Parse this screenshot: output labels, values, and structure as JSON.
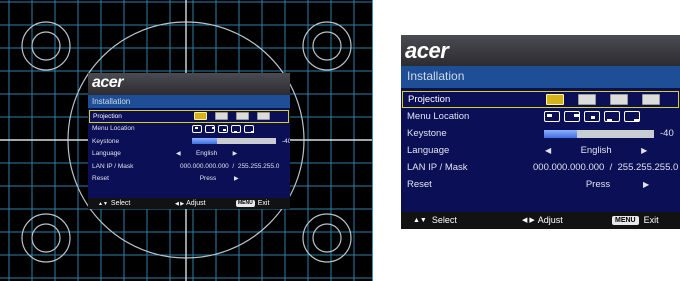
{
  "brand": "acer",
  "menu": {
    "title": "Installation",
    "rows": [
      {
        "label": "Projection",
        "type": "icons",
        "selected": true
      },
      {
        "label": "Menu Location",
        "type": "location"
      },
      {
        "label": "Keystone",
        "type": "slider",
        "value": "-40",
        "level": 0.3
      },
      {
        "label": "Language",
        "type": "choice",
        "value": "English"
      },
      {
        "label": "LAN IP / Mask",
        "type": "text",
        "value": "000.000.000.000  /  255.255.255.0"
      },
      {
        "label": "Reset",
        "type": "action",
        "value": "Press"
      }
    ],
    "footer": {
      "select_glyph": "▲▼",
      "select_label": "Select",
      "adjust_glyph": "◀ ▶",
      "adjust_label": "Adjust",
      "menu_key": "MENU",
      "exit_label": "Exit"
    },
    "projection_icons": [
      "front-desktop-icon",
      "rear-desktop-icon",
      "front-ceiling-icon",
      "rear-ceiling-icon"
    ],
    "location_icons": [
      "top-left-location-icon",
      "top-right-location-icon",
      "center-location-icon",
      "bottom-left-location-icon",
      "bottom-right-location-icon"
    ],
    "arrows": {
      "left": "◀",
      "right": "▶"
    },
    "colors": {
      "title_bar": "#1e4f96",
      "body": "#0b0f55",
      "highlight": "#d9d11b",
      "footer": "#121212",
      "grid_line": "#2f7fa8"
    }
  }
}
